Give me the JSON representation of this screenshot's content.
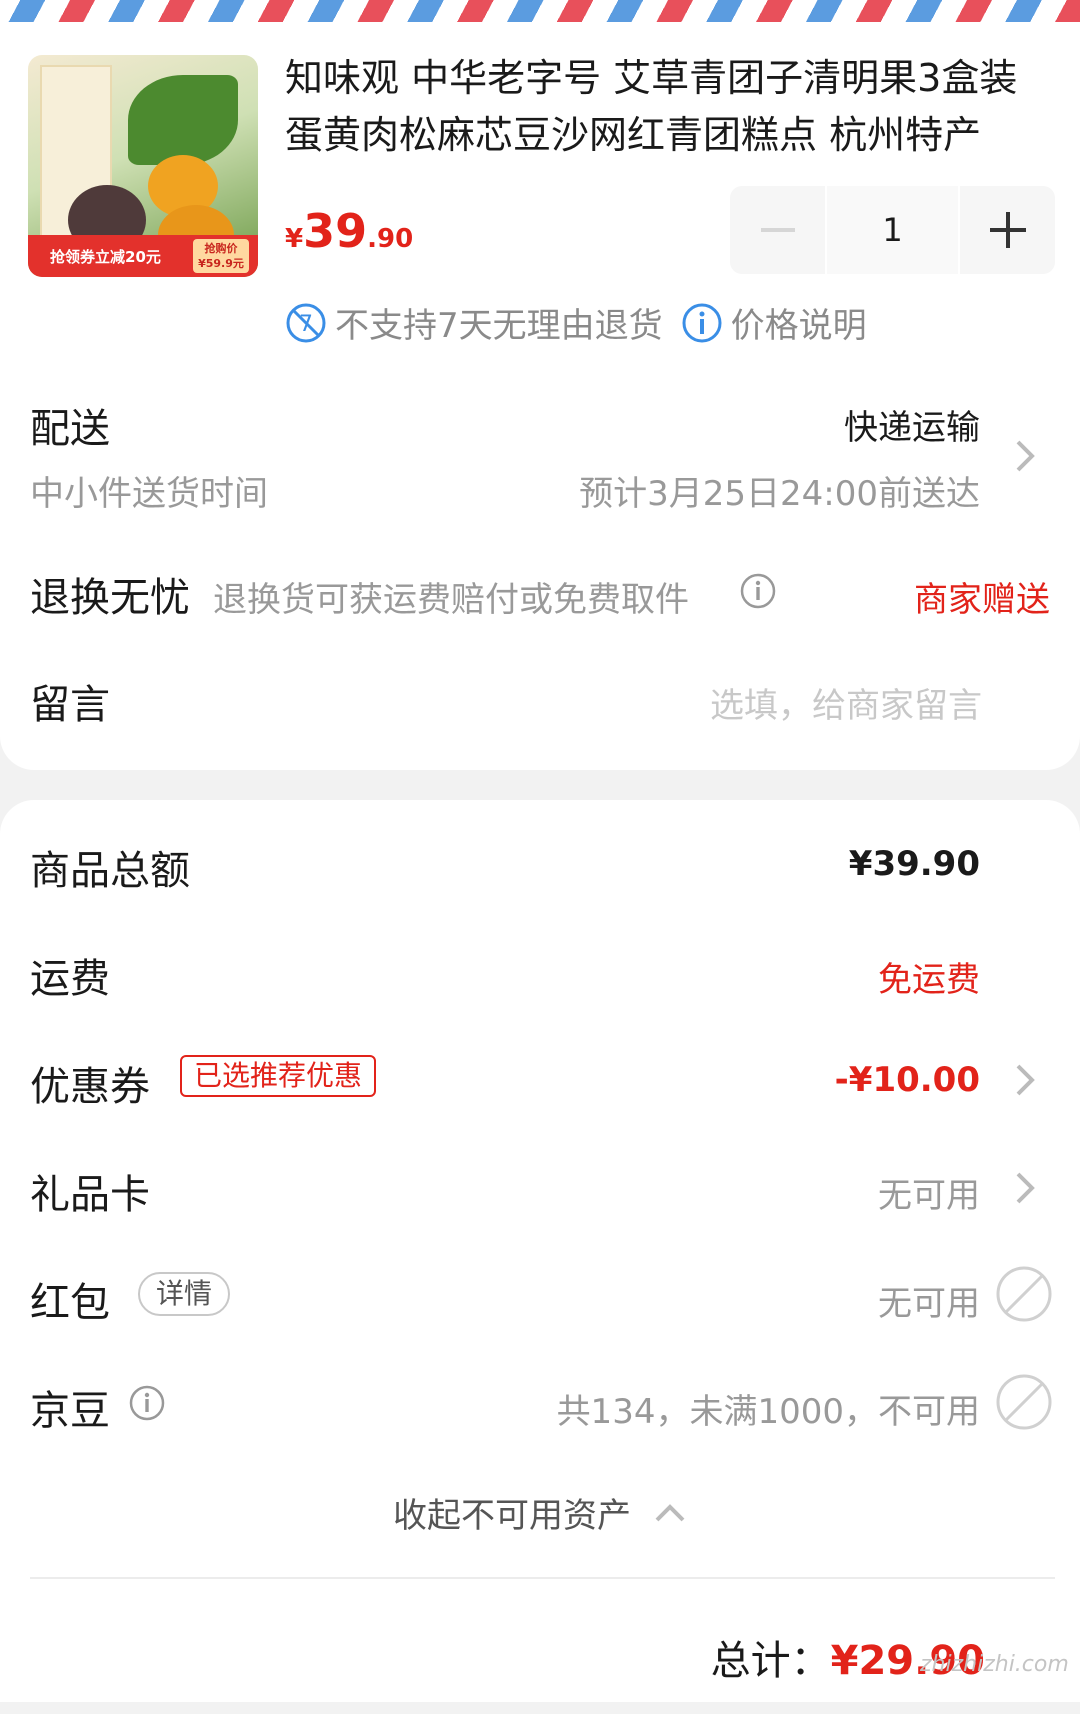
{
  "product": {
    "title": "知味观 中华老字号 艾草青团子清明果3盒装 蛋黄肉松麻芯豆沙网红青团糕点 杭州特产",
    "price_currency": "¥",
    "price_integer": "39",
    "price_decimal": ".90",
    "quantity": "1",
    "thumb_ribbon": "抢领券立减20元",
    "thumb_box_line1": "抢购价",
    "thumb_box_line2": "¥59.9元",
    "tag_no_return": "不支持7天无理由退货",
    "tag_price_info": "价格说明"
  },
  "delivery": {
    "label": "配送",
    "method": "快递运输",
    "sub_label": "中小件送货时间",
    "eta": "预计3月25日24:00前送达"
  },
  "return": {
    "label": "退换无忧",
    "desc": "退换货可获运费赔付或免费取件",
    "value": "商家赠送"
  },
  "message": {
    "label": "留言",
    "placeholder": "选填，给商家留言"
  },
  "summary": {
    "goods_total_label": "商品总额",
    "goods_total_value": "¥39.90",
    "shipping_label": "运费",
    "shipping_value": "免运费",
    "coupon_label": "优惠券",
    "coupon_badge": "已选推荐优惠",
    "coupon_value": "-¥10.00",
    "giftcard_label": "礼品卡",
    "giftcard_value": "无可用",
    "redpacket_label": "红包",
    "redpacket_badge": "详情",
    "redpacket_value": "无可用",
    "jingdou_label": "京豆",
    "jingdou_value": "共134，未满1000，不可用",
    "collapse_label": "收起不可用资产",
    "total_label": "总计：",
    "total_value": "¥29.90"
  },
  "watermark": "zhizhizhi.com",
  "colors": {
    "accent_red": "#e2231a",
    "info_blue": "#3a8ee6",
    "muted_grey": "#999999"
  }
}
